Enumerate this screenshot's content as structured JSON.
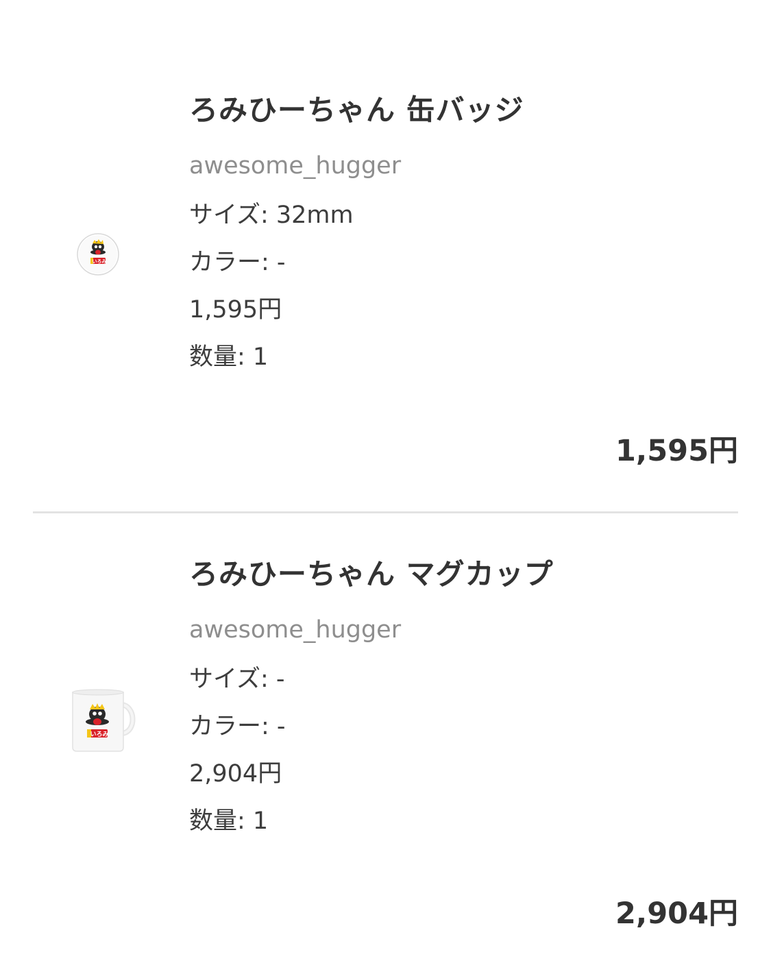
{
  "items": [
    {
      "title": "ろみひーちゃん 缶バッジ",
      "seller": "awesome_hugger",
      "size": "サイズ: 32mm",
      "color": "カラー: -",
      "unit_price": "1,595円",
      "quantity": "数量: 1",
      "total": "1,595円",
      "thumbnail_icon": "can-badge-thumbnail"
    },
    {
      "title": "ろみひーちゃん マグカップ",
      "seller": "awesome_hugger",
      "size": "サイズ: -",
      "color": "カラー: -",
      "unit_price": "2,904円",
      "quantity": "数量: 1",
      "total": "2,904円",
      "thumbnail_icon": "mug-thumbnail"
    }
  ],
  "colors": {
    "text": "#333333",
    "muted": "#8e8e8e",
    "divider": "#e3e3e3",
    "logo_red": "#d9232a",
    "logo_yellow": "#f5c518"
  }
}
